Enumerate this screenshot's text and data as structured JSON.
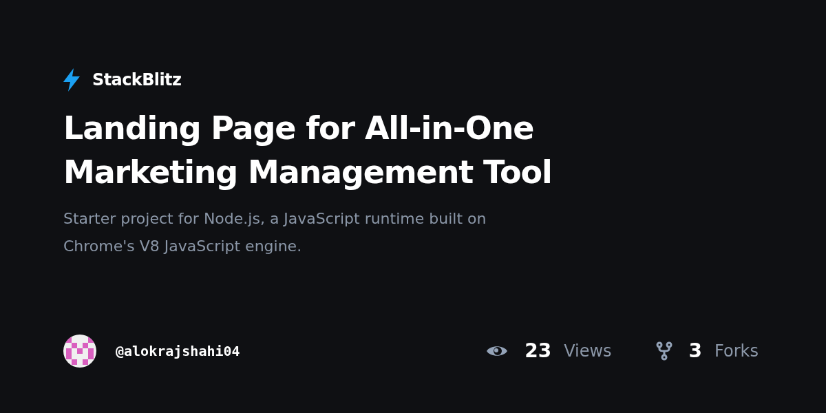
{
  "brand": "StackBlitz",
  "title": "Landing Page for All-in-One Marketing Management Tool",
  "description": "Starter project for Node.js, a JavaScript runtime built on Chrome's V8 JavaScript engine.",
  "author": "@alokrajshahi04",
  "stats": [
    {
      "kind": "views",
      "count": "23",
      "label": "Views"
    },
    {
      "kind": "forks",
      "count": "3",
      "label": "Forks"
    }
  ]
}
